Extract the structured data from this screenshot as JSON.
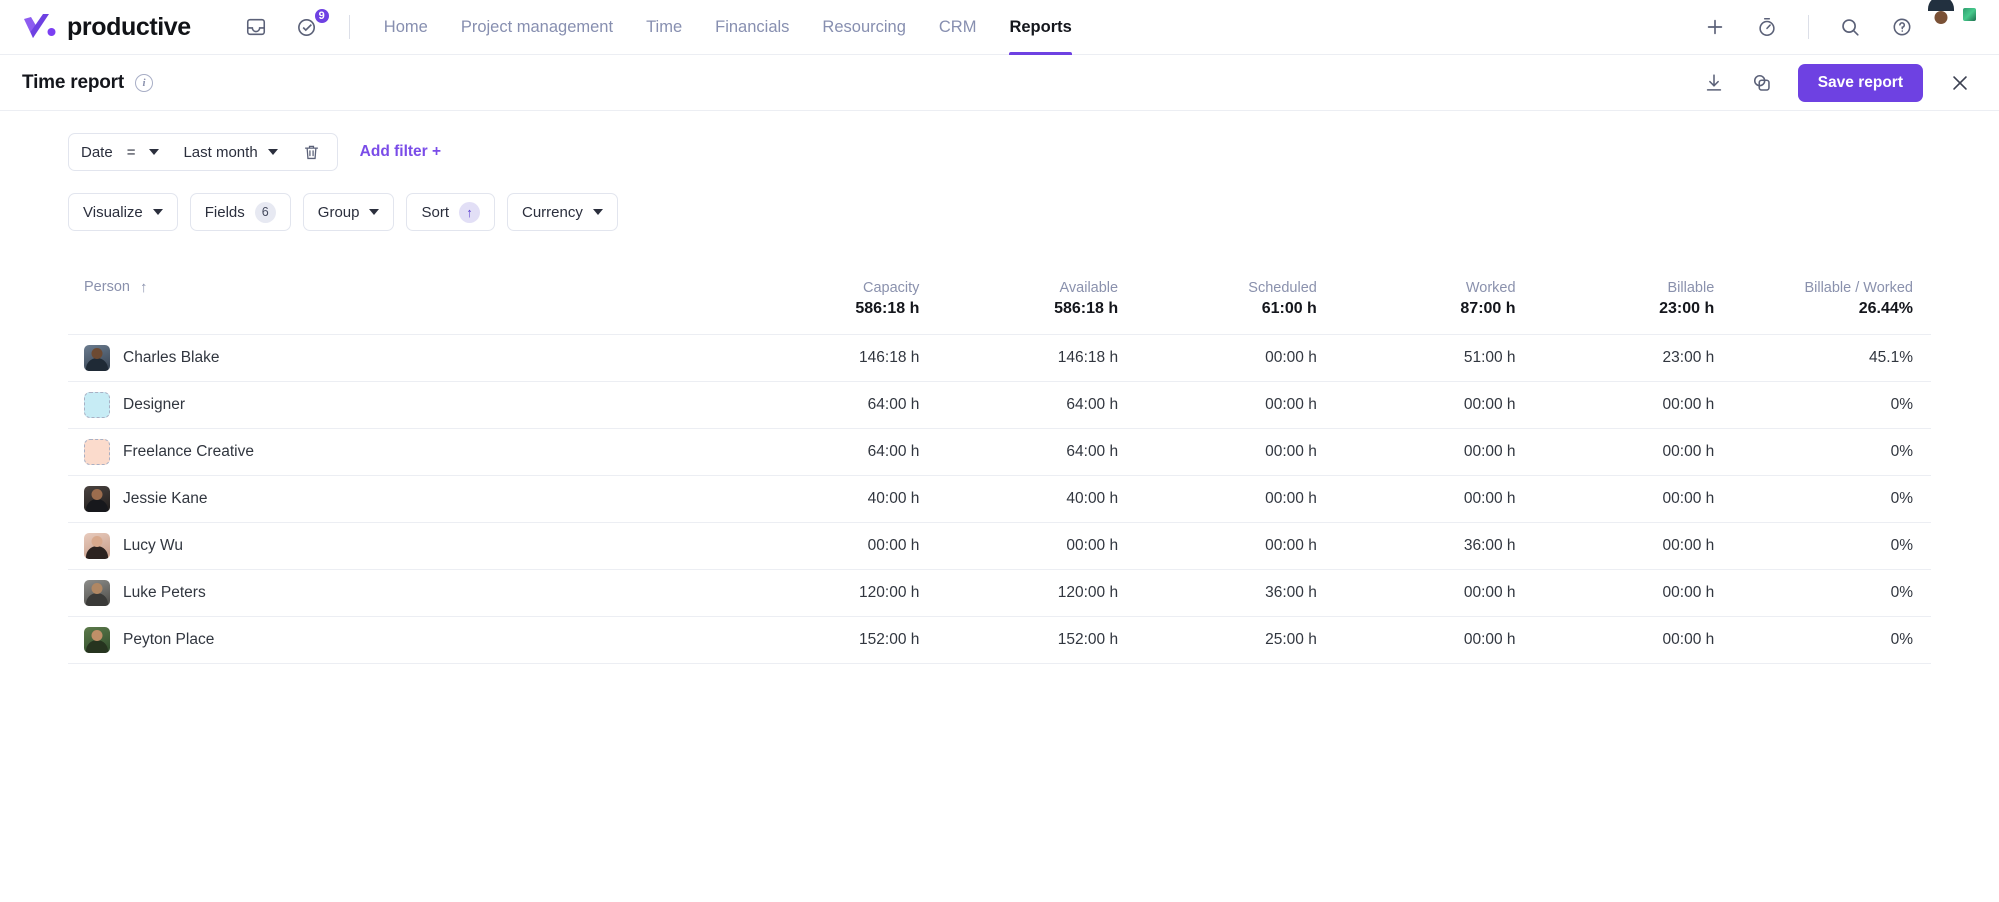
{
  "brand": {
    "name": "productive"
  },
  "topnav": {
    "icons": [
      {
        "name": "inbox-icon",
        "label": "Inbox"
      },
      {
        "name": "tasks-icon",
        "label": "Tasks",
        "badge": "9"
      }
    ],
    "links": [
      {
        "label": "Home",
        "active": false
      },
      {
        "label": "Project management",
        "active": false
      },
      {
        "label": "Time",
        "active": false
      },
      {
        "label": "Financials",
        "active": false
      },
      {
        "label": "Resourcing",
        "active": false
      },
      {
        "label": "CRM",
        "active": false
      },
      {
        "label": "Reports",
        "active": true
      }
    ],
    "right_icons": [
      {
        "name": "plus-icon",
        "label": "Create"
      },
      {
        "name": "timer-icon",
        "label": "Timer"
      },
      {
        "name": "search-icon",
        "label": "Search"
      },
      {
        "name": "help-icon",
        "label": "Help"
      }
    ],
    "avatar": {
      "name": "user-avatar",
      "status": "online"
    }
  },
  "report_header": {
    "title": "Time report",
    "info_glyph": "i",
    "actions": [
      {
        "name": "download-icon",
        "label": "Download"
      },
      {
        "name": "duplicate-icon",
        "label": "Duplicate"
      }
    ],
    "save_label": "Save report",
    "close_glyph": "✕"
  },
  "filters": {
    "field": "Date",
    "operator": "=",
    "value": "Last month",
    "delete_label": "Delete filter",
    "add_label": "Add filter +"
  },
  "toolbar": {
    "visualize": "Visualize",
    "fields": "Fields",
    "fields_count": "6",
    "group": "Group",
    "sort": "Sort",
    "sort_direction": "↑",
    "currency": "Currency"
  },
  "table": {
    "sort_arrow": "↑",
    "columns": [
      {
        "label": "Person",
        "total": "",
        "type": "text"
      },
      {
        "label": "Capacity",
        "total": "586:18 h",
        "type": "num"
      },
      {
        "label": "Available",
        "total": "586:18 h",
        "type": "num"
      },
      {
        "label": "Scheduled",
        "total": "61:00 h",
        "type": "num"
      },
      {
        "label": "Worked",
        "total": "87:00 h",
        "type": "num"
      },
      {
        "label": "Billable",
        "total": "23:00 h",
        "type": "num"
      },
      {
        "label": "Billable / Worked",
        "total": "26.44%",
        "type": "num"
      }
    ],
    "rows": [
      {
        "person": "Charles Blake",
        "avatar_kind": "photo",
        "avatar_class": "a-charles",
        "capacity": "146:18 h",
        "available": "146:18 h",
        "scheduled": "00:00 h",
        "worked": "51:00 h",
        "billable": "23:00 h",
        "billable_worked": "45.1%"
      },
      {
        "person": "Designer",
        "avatar_kind": "placeholder",
        "avatar_color": "#c7ecf5",
        "capacity": "64:00 h",
        "available": "64:00 h",
        "scheduled": "00:00 h",
        "worked": "00:00 h",
        "billable": "00:00 h",
        "billable_worked": "0%"
      },
      {
        "person": "Freelance Creative",
        "avatar_kind": "placeholder",
        "avatar_color": "#fbdbcc",
        "capacity": "64:00 h",
        "available": "64:00 h",
        "scheduled": "00:00 h",
        "worked": "00:00 h",
        "billable": "00:00 h",
        "billable_worked": "0%"
      },
      {
        "person": "Jessie Kane",
        "avatar_kind": "photo",
        "avatar_class": "a-jessie",
        "capacity": "40:00 h",
        "available": "40:00 h",
        "scheduled": "00:00 h",
        "worked": "00:00 h",
        "billable": "00:00 h",
        "billable_worked": "0%"
      },
      {
        "person": "Lucy Wu",
        "avatar_kind": "photo",
        "avatar_class": "a-lucy",
        "capacity": "00:00 h",
        "available": "00:00 h",
        "scheduled": "00:00 h",
        "worked": "36:00 h",
        "billable": "00:00 h",
        "billable_worked": "0%"
      },
      {
        "person": "Luke Peters",
        "avatar_kind": "photo",
        "avatar_class": "a-luke",
        "capacity": "120:00 h",
        "available": "120:00 h",
        "scheduled": "36:00 h",
        "worked": "00:00 h",
        "billable": "00:00 h",
        "billable_worked": "0%"
      },
      {
        "person": "Peyton Place",
        "avatar_kind": "photo",
        "avatar_class": "a-peyton",
        "capacity": "152:00 h",
        "available": "152:00 h",
        "scheduled": "25:00 h",
        "worked": "00:00 h",
        "billable": "00:00 h",
        "billable_worked": "0%"
      }
    ]
  },
  "colors": {
    "accent": "#6e41e2",
    "link": "#7a4ce8",
    "text": "#14161c",
    "muted": "#8a91ad",
    "border": "#eceef3"
  }
}
